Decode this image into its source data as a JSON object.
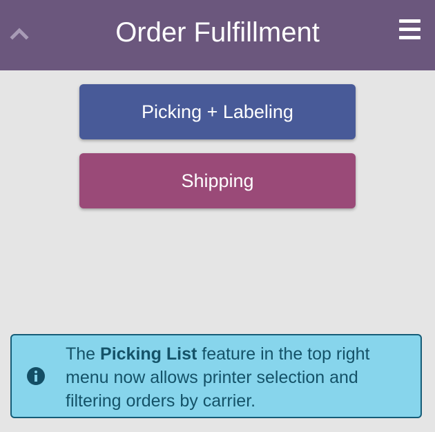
{
  "header": {
    "back_icon": "chevron-up-icon",
    "title": "Order Fulfillment",
    "menu_icon": "hamburger-menu-icon",
    "background": "#6b577d"
  },
  "actions": [
    {
      "label": "Picking + Labeling",
      "color": "#485a98"
    },
    {
      "label": "Shipping",
      "color": "#9a4a78"
    }
  ],
  "notice": {
    "icon": "info-circle-icon",
    "text_before": "The ",
    "highlight": "Picking List",
    "text_after": " feature in the top right menu now allows printer selection and filtering orders by carrier.",
    "background": "#87d5ec",
    "border": "#155c77"
  }
}
